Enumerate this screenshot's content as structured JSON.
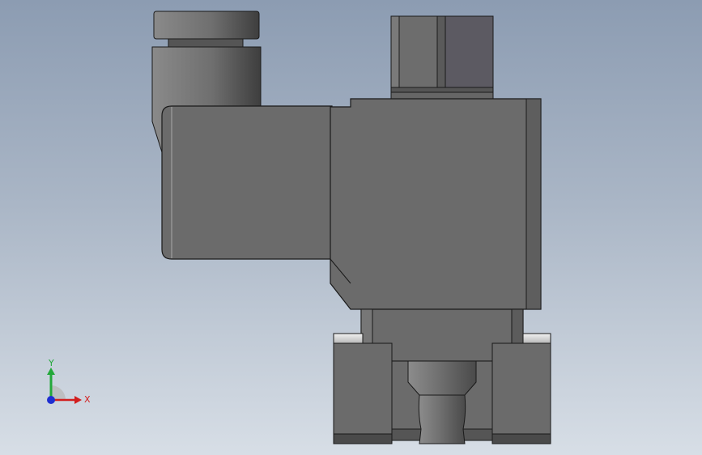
{
  "window": {
    "title": ""
  },
  "viewport": {
    "background_top": "#8c9cb2",
    "background_bottom": "#d7dee6"
  },
  "model": {
    "part_fill": "#6b6b6b",
    "part_dark": "#5a5a5a",
    "part_light": "#8a8a8a",
    "edge_color": "#1a1a1a"
  },
  "triad": {
    "x_label": "X",
    "y_label": "Y",
    "x_color": "#d21e1e",
    "y_color": "#23a83a",
    "z_color": "#1f2fd1"
  }
}
